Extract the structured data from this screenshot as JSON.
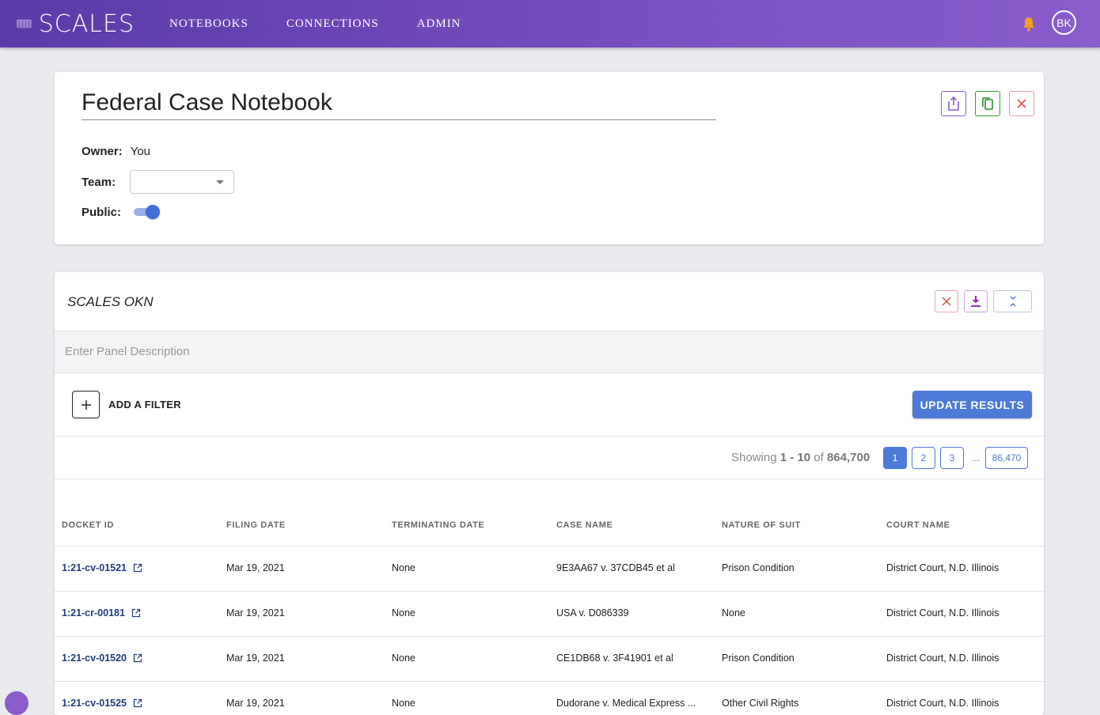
{
  "header": {
    "logo_text": "SCALES",
    "nav": [
      "NOTEBOOKS",
      "CONNECTIONS",
      "ADMIN"
    ],
    "avatar": "BK",
    "accent_color": "#7a4fc0"
  },
  "notebook": {
    "title": "Federal Case Notebook",
    "owner_label": "Owner:",
    "owner_value": "You",
    "team_label": "Team:",
    "team_value": "",
    "public_label": "Public:",
    "public_on": true,
    "actions": [
      "share-icon",
      "copy-icon",
      "close-icon"
    ]
  },
  "panel": {
    "title": "SCALES OKN",
    "description_placeholder": "Enter Panel Description",
    "add_filter_label": "ADD A FILTER",
    "update_label": "UPDATE RESULTS",
    "showing_prefix": "Showing ",
    "showing_range": "1 - 10",
    "showing_of": " of ",
    "showing_total": "864,700",
    "pages": [
      "1",
      "2",
      "3"
    ],
    "ellipsis": "...",
    "last_page": "86,470",
    "columns": [
      "DOCKET ID",
      "FILING DATE",
      "TERMINATING DATE",
      "CASE NAME",
      "NATURE OF SUIT",
      "COURT NAME"
    ],
    "rows": [
      {
        "docket": "1:21-cv-01521",
        "filing": "Mar 19, 2021",
        "terminating": "None",
        "case": "9E3AA67 v. 37CDB45 et al",
        "nature": "Prison Condition",
        "court": "District Court, N.D. Illinois"
      },
      {
        "docket": "1:21-cr-00181",
        "filing": "Mar 19, 2021",
        "terminating": "None",
        "case": "USA v. D086339",
        "nature": "None",
        "court": "District Court, N.D. Illinois"
      },
      {
        "docket": "1:21-cv-01520",
        "filing": "Mar 19, 2021",
        "terminating": "None",
        "case": "CE1DB68 v. 3F41901 et al",
        "nature": "Prison Condition",
        "court": "District Court, N.D. Illinois"
      },
      {
        "docket": "1:21-cv-01525",
        "filing": "Mar 19, 2021",
        "terminating": "None",
        "case": "Dudorane v. Medical Express ...",
        "nature": "Other Civil Rights",
        "court": "District Court, N.D. Illinois"
      }
    ]
  }
}
